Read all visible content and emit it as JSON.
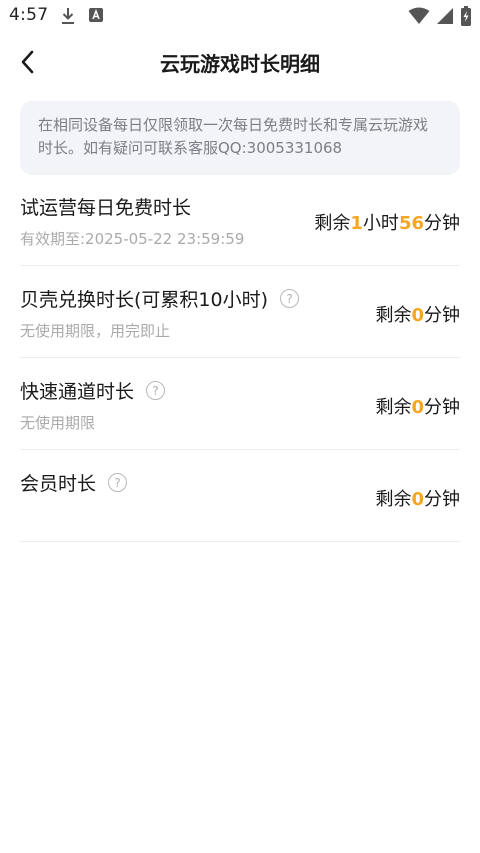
{
  "status_bar": {
    "time": "4:57",
    "left_icons": [
      "download-icon",
      "app-notification-icon"
    ],
    "right_icons": [
      "wifi-icon",
      "signal-icon",
      "battery-charging-icon"
    ]
  },
  "header": {
    "title": "云玩游戏时长明细",
    "back_icon": "chevron-left-icon"
  },
  "notice": {
    "text": "在相同设备每日仅限领取一次每日免费时长和专属云玩游戏时长。如有疑问可联系客服QQ:3005331068"
  },
  "items": [
    {
      "title": "试运营每日免费时长",
      "subtitle": "有效期至:2025-05-22 23:59:59",
      "prefix": "剩余",
      "hours": "1",
      "hour_unit": "小时",
      "minutes": "56",
      "minute_unit": "分钟",
      "has_help": false
    },
    {
      "title": "贝壳兑换时长(可累积10小时)",
      "subtitle": "无使用期限，用完即止",
      "prefix": "剩余",
      "minutes": "0",
      "minute_unit": "分钟",
      "has_help": true,
      "help_glyph": "?"
    },
    {
      "title": "快速通道时长",
      "subtitle": "无使用期限",
      "prefix": "剩余",
      "minutes": "0",
      "minute_unit": "分钟",
      "has_help": true,
      "help_glyph": "?"
    },
    {
      "title": "会员时长",
      "prefix": "剩余",
      "minutes": "0",
      "minute_unit": "分钟",
      "has_help": true,
      "help_glyph": "?"
    }
  ],
  "colors": {
    "accent_number": "#f5a623",
    "notice_bg": "#f3f4f7",
    "divider": "#ececec"
  }
}
